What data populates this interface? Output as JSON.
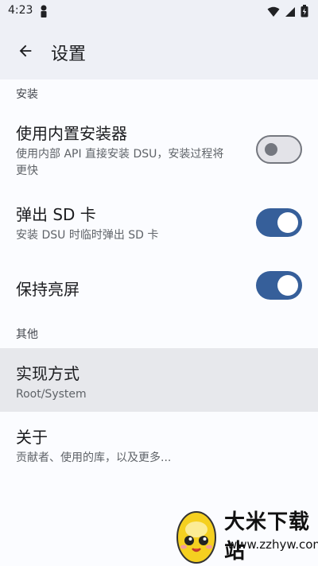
{
  "status_bar": {
    "time": "4:23"
  },
  "app_bar": {
    "title": "设置"
  },
  "sections": {
    "install": "安装",
    "other": "其他"
  },
  "prefs": {
    "builtin_installer": {
      "title": "使用内置安装器",
      "summary_line1": "使用内部 API 直接安装 DSU，安装过程将",
      "summary_line2": "更快",
      "enabled": false
    },
    "eject_sd": {
      "title": "弹出 SD 卡",
      "summary": "安装 DSU 时临时弹出 SD 卡",
      "enabled": true
    },
    "keep_screen_on": {
      "title": "保持亮屏",
      "enabled": true
    },
    "implementation": {
      "title": "实现方式",
      "summary": "Root/System"
    },
    "about": {
      "title": "关于",
      "summary": "贡献者、使用的库，以及更多..."
    }
  },
  "watermark": {
    "name": "大米下载站",
    "url": "www.zzhyw.com"
  },
  "colors": {
    "accent": "#365f9a",
    "toolbar": "#eef0f6",
    "highlight": "#e7e8ec"
  }
}
